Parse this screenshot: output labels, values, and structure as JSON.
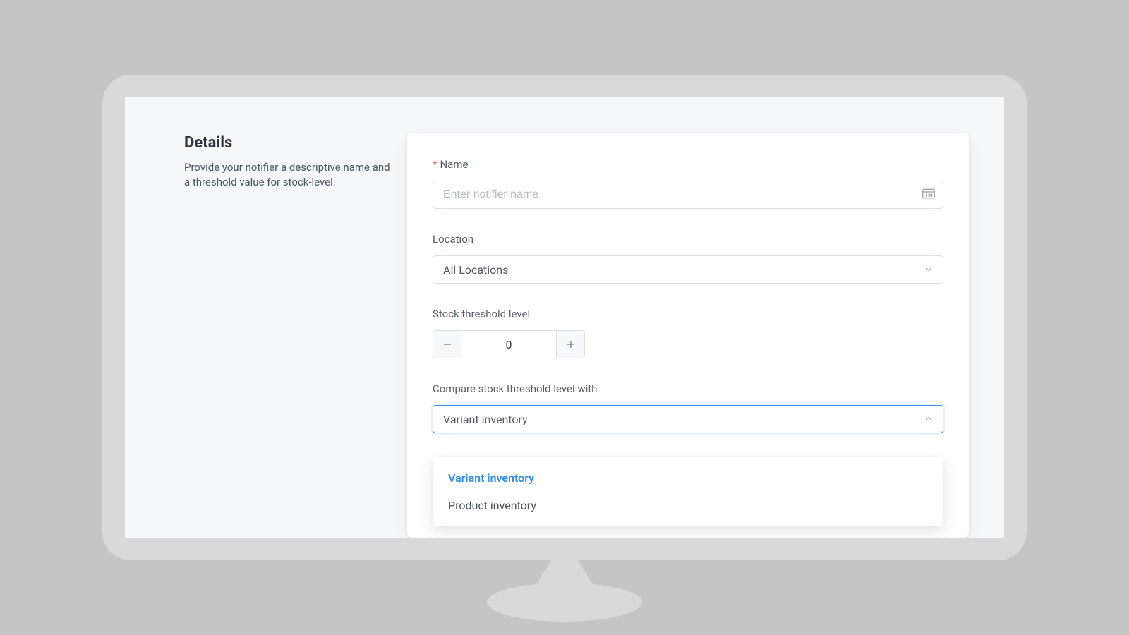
{
  "sidebar": {
    "title": "Details",
    "description": "Provide your notifier a descriptive name and a threshold value for stock-level."
  },
  "form": {
    "name": {
      "required_marker": "*",
      "label": "Name",
      "placeholder": "Enter notifier name",
      "value": ""
    },
    "location": {
      "label": "Location",
      "value": "All Locations"
    },
    "threshold": {
      "label": "Stock threshold level",
      "value": "0"
    },
    "compare": {
      "label": "Compare stock threshold level with",
      "value": "Variant inventory",
      "options": [
        "Variant inventory",
        "Product inventory"
      ]
    }
  }
}
